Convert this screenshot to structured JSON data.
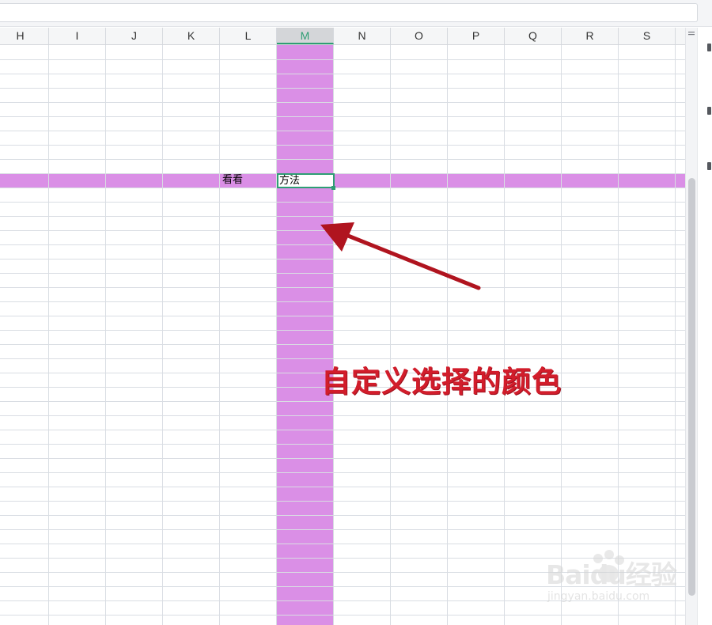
{
  "columns": [
    "H",
    "I",
    "J",
    "K",
    "L",
    "M",
    "N",
    "O",
    "P",
    "Q",
    "R",
    "S"
  ],
  "selected_column": "M",
  "cells": {
    "L_value": "看看",
    "M_value": "方法"
  },
  "highlight_color": "#da8fe6",
  "annotation": {
    "text": "自定义选择的颜色",
    "color": "#d21d2b"
  },
  "watermark": {
    "text": "Baidu经验",
    "subtext": "jingyan.baidu.com"
  }
}
